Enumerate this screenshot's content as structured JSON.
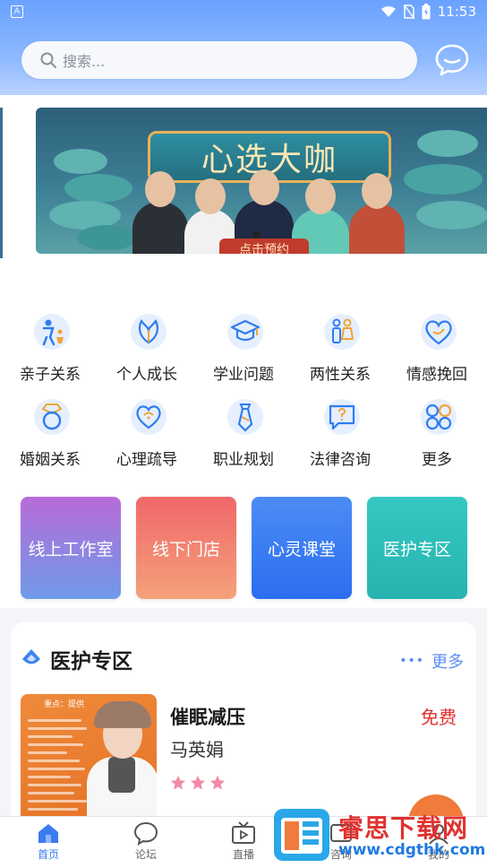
{
  "status_bar": {
    "time": "11:53",
    "left_badge": "A"
  },
  "search": {
    "placeholder": "搜索..."
  },
  "banner": {
    "title": "心选大咖",
    "cta": "点击预约"
  },
  "categories": [
    {
      "label": "亲子关系",
      "icon": "parent-child-icon"
    },
    {
      "label": "个人成长",
      "icon": "leaf-icon"
    },
    {
      "label": "学业问题",
      "icon": "graduation-cap-icon"
    },
    {
      "label": "两性关系",
      "icon": "couple-icon"
    },
    {
      "label": "情感挽回",
      "icon": "heart-icon"
    },
    {
      "label": "婚姻关系",
      "icon": "ring-icon"
    },
    {
      "label": "心理疏导",
      "icon": "heart-chat-icon"
    },
    {
      "label": "职业规划",
      "icon": "tie-icon"
    },
    {
      "label": "法律咨询",
      "icon": "question-chat-icon"
    },
    {
      "label": "更多",
      "icon": "grid-more-icon"
    }
  ],
  "quick_cards": [
    {
      "label": "线上工作室"
    },
    {
      "label": "线下门店"
    },
    {
      "label": "心灵课堂"
    },
    {
      "label": "医护专区"
    }
  ],
  "medical": {
    "title": "医护专区",
    "more_label": "更多",
    "items": [
      {
        "title": "催眠减压",
        "author": "马英娟",
        "price": "免费",
        "rating": 3,
        "poster_tag": "重点：提供"
      }
    ]
  },
  "bottom_nav": [
    {
      "label": "首页",
      "icon": "home-icon",
      "active": true
    },
    {
      "label": "论坛",
      "icon": "forum-icon",
      "active": false
    },
    {
      "label": "直播",
      "icon": "live-tv-icon",
      "active": false
    },
    {
      "label": "咨询",
      "icon": "consult-icon",
      "active": false
    },
    {
      "label": "我的",
      "icon": "profile-icon",
      "active": false
    }
  ],
  "watermark": {
    "name": "睿思下载网",
    "url": "www.cdgthk.com"
  },
  "colors": {
    "accent": "#3b7bf0",
    "price": "#e0322f",
    "header": "#6aa2ff"
  }
}
